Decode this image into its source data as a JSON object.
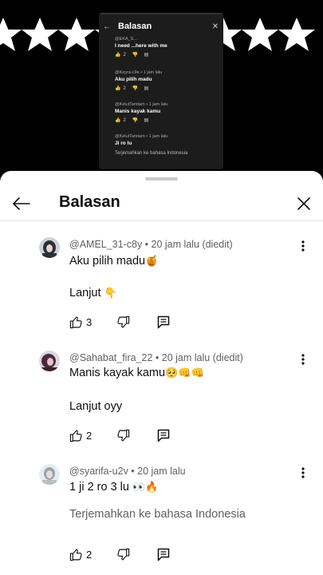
{
  "video": {
    "inner_title": "Balasan",
    "inner_comments": [
      {
        "user": "@EKA_S...",
        "text": "I need ...here with me",
        "likes": "2"
      },
      {
        "user": "@Keyra-c9e • 1 jam lalu",
        "text": "Aku pilih madu",
        "likes": "2"
      },
      {
        "user": "@KetulTamtam • 1 jam lalu",
        "text": "Manis kayak kamu",
        "likes": "2"
      },
      {
        "user": "@KetulTamtam • 1 jam lalu",
        "text": "Ji ro lu",
        "translate": "Terjemahkan ke bahasa Indonesia"
      }
    ]
  },
  "header": {
    "title": "Balasan"
  },
  "comments": [
    {
      "meta": "@AMEL_31-c8y • 20 jam lalu (diedit)",
      "line1": "Aku pilih madu",
      "emoji1": "🍯",
      "line2": "Lanjut",
      "emoji2": "👇",
      "likes": "3",
      "avatar_color": "#2b2f3a"
    },
    {
      "meta": "@Sahabat_fira_22 • 20 jam lalu (diedit)",
      "line1": "Manis kayak kamu",
      "emoji1": "🥺👊👊",
      "line2": "Lanjut oyy",
      "likes": "2",
      "avatar_color": "#4a2a40"
    },
    {
      "meta": "@syarifa-u2v • 20 jam lalu",
      "line1": "1 ji 2 ro 3 lu",
      "emoji1": "👀🔥",
      "translate": "Terjemahkan ke bahasa Indonesia",
      "likes": "2",
      "avatar_color": "#9aa3a8"
    }
  ],
  "colors": {
    "sheet_bg": "#ffffff",
    "text_primary": "#0f0f0f",
    "text_secondary": "#606060"
  }
}
